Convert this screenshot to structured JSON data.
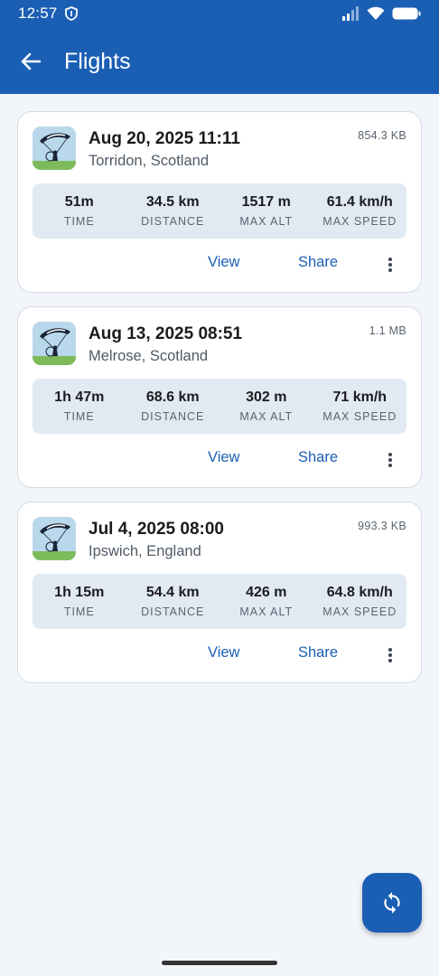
{
  "status_bar": {
    "time": "12:57"
  },
  "header": {
    "title": "Flights"
  },
  "flights": [
    {
      "date": "Aug 20, 2025 11:11",
      "location": "Torridon, Scotland",
      "size": "854.3 KB",
      "stats": [
        {
          "value": "51m",
          "label": "TIME"
        },
        {
          "value": "34.5 km",
          "label": "DISTANCE"
        },
        {
          "value": "1517 m",
          "label": "MAX ALT"
        },
        {
          "value": "61.4 km/h",
          "label": "MAX SPEED"
        }
      ],
      "view_label": "View",
      "share_label": "Share"
    },
    {
      "date": "Aug 13, 2025 08:51",
      "location": "Melrose, Scotland",
      "size": "1.1 MB",
      "stats": [
        {
          "value": "1h 47m",
          "label": "TIME"
        },
        {
          "value": "68.6 km",
          "label": "DISTANCE"
        },
        {
          "value": "302 m",
          "label": "MAX ALT"
        },
        {
          "value": "71 km/h",
          "label": "MAX SPEED"
        }
      ],
      "view_label": "View",
      "share_label": "Share"
    },
    {
      "date": "Jul 4, 2025 08:00",
      "location": "Ipswich, England",
      "size": "993.3 KB",
      "stats": [
        {
          "value": "1h 15m",
          "label": "TIME"
        },
        {
          "value": "54.4 km",
          "label": "DISTANCE"
        },
        {
          "value": "426 m",
          "label": "MAX ALT"
        },
        {
          "value": "64.8 km/h",
          "label": "MAX SPEED"
        }
      ],
      "view_label": "View",
      "share_label": "Share"
    }
  ],
  "icons": {
    "back": "arrow-left-icon",
    "more": "more-vert-icon",
    "sync": "sync-icon",
    "thumbnail": "paramotor-icon"
  },
  "colors": {
    "primary": "#1b5fb4",
    "background": "#f2f5f9",
    "stats_bg": "#e1e9f2"
  }
}
